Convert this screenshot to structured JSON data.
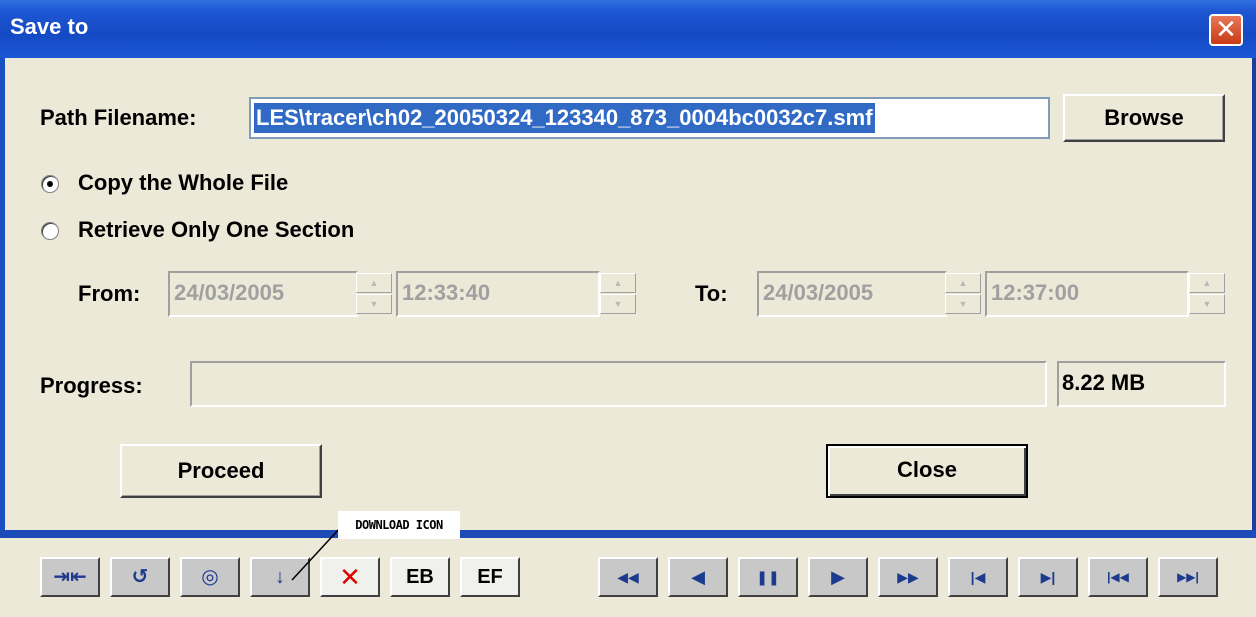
{
  "window": {
    "title": "Save to",
    "close_glyph": "✕"
  },
  "path": {
    "label": "Path Filename:",
    "value": "LES\\tracer\\ch02_20050324_123340_873_0004bc0032c7.smf",
    "browse_label": "Browse"
  },
  "options": {
    "copy_whole_label": "Copy the Whole File",
    "copy_whole_selected": true,
    "retrieve_section_label": "Retrieve Only One Section",
    "retrieve_section_selected": false
  },
  "range": {
    "from_label": "From:",
    "from_date": "24/03/2005",
    "from_time": "12:33:40",
    "to_label": "To:",
    "to_date": "24/03/2005",
    "to_time": "12:37:00"
  },
  "progress": {
    "label": "Progress:",
    "fraction": 0,
    "size": "8.22 MB"
  },
  "actions": {
    "proceed_label": "Proceed",
    "close_label": "Close"
  },
  "annotation": {
    "text": "DOWNLOAD ICON"
  },
  "toolbar": {
    "left_buttons": [
      {
        "name": "expand-icon",
        "glyph": "⇥⇤"
      },
      {
        "name": "refresh-icon",
        "glyph": "↺"
      },
      {
        "name": "record-icon",
        "glyph": "◎"
      },
      {
        "name": "download-icon",
        "glyph": "↓"
      },
      {
        "name": "delete-icon",
        "glyph": "✕"
      },
      {
        "name": "eb",
        "text": "EB"
      },
      {
        "name": "ef",
        "text": "EF"
      }
    ],
    "right_buttons": [
      {
        "name": "fast-rewind-icon",
        "glyph": "◀◀"
      },
      {
        "name": "play-reverse-icon",
        "glyph": "◀"
      },
      {
        "name": "pause-icon",
        "glyph": "❚❚"
      },
      {
        "name": "play-icon",
        "glyph": "▶"
      },
      {
        "name": "fast-forward-icon",
        "glyph": "▶▶"
      },
      {
        "name": "step-back-icon",
        "glyph": "|◀"
      },
      {
        "name": "step-forward-icon",
        "glyph": "▶|"
      },
      {
        "name": "skip-start-icon",
        "glyph": "|◀◀"
      },
      {
        "name": "skip-end-icon",
        "glyph": "▶▶|"
      }
    ]
  },
  "colors": {
    "titlebar": "#1549c4",
    "selection": "#316ac5",
    "dialog_bg": "#ece9d8"
  }
}
